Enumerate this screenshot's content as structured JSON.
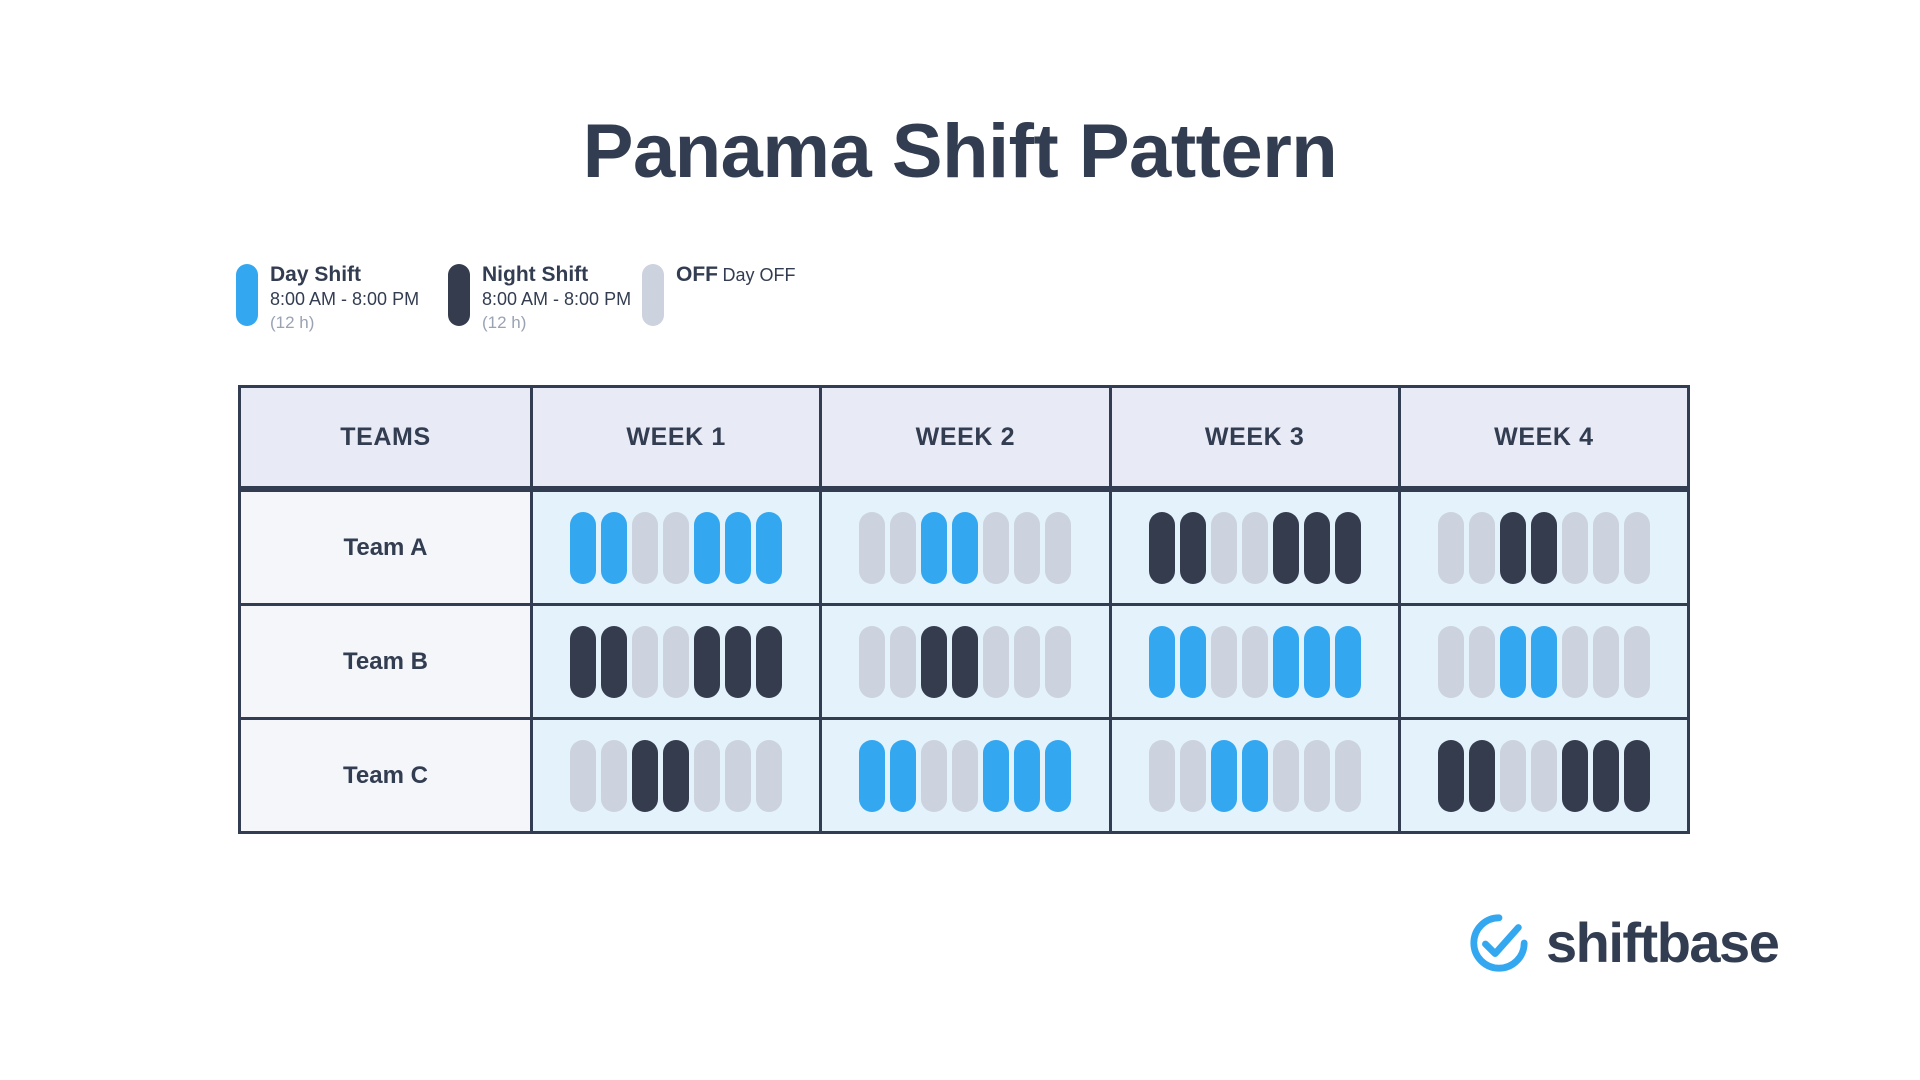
{
  "title": "Panama Shift Pattern",
  "colors": {
    "day": "#33a7f0",
    "night": "#343c4e",
    "off": "#ccd2de",
    "text_dark": "#333d51",
    "header_bg": "#e8ebf5",
    "team_cell_bg": "#f4f6f9",
    "week_cell_bg": "#e3f2fb",
    "border": "#333d51"
  },
  "legend": [
    {
      "key": "day",
      "label": "Day Shift",
      "time": "8:00 AM - 8:00 PM",
      "duration": "(12 h)"
    },
    {
      "key": "night",
      "label": "Night Shift",
      "time": "8:00 AM - 8:00 PM",
      "duration": "(12 h)"
    },
    {
      "key": "off",
      "label": "OFF",
      "time": "Day OFF",
      "duration": ""
    }
  ],
  "table": {
    "headers": [
      "TEAMS",
      "WEEK 1",
      "WEEK 2",
      "WEEK 3",
      "WEEK 4"
    ],
    "rows": [
      {
        "team": "Team A",
        "weeks": [
          [
            "D",
            "D",
            "O",
            "O",
            "D",
            "D",
            "D"
          ],
          [
            "O",
            "O",
            "D",
            "D",
            "O",
            "O",
            "O"
          ],
          [
            "N",
            "N",
            "O",
            "O",
            "N",
            "N",
            "N"
          ],
          [
            "O",
            "O",
            "N",
            "N",
            "O",
            "O",
            "O"
          ]
        ]
      },
      {
        "team": "Team B",
        "weeks": [
          [
            "N",
            "N",
            "O",
            "O",
            "N",
            "N",
            "N"
          ],
          [
            "O",
            "O",
            "N",
            "N",
            "O",
            "O",
            "O"
          ],
          [
            "D",
            "D",
            "O",
            "O",
            "D",
            "D",
            "D"
          ],
          [
            "O",
            "O",
            "D",
            "D",
            "O",
            "O",
            "O"
          ]
        ]
      },
      {
        "team": "Team C",
        "weeks": [
          [
            "O",
            "O",
            "N",
            "N",
            "O",
            "O",
            "O"
          ],
          [
            "D",
            "D",
            "O",
            "O",
            "D",
            "D",
            "D"
          ],
          [
            "O",
            "O",
            "D",
            "D",
            "O",
            "O",
            "O"
          ],
          [
            "N",
            "N",
            "O",
            "O",
            "N",
            "N",
            "N"
          ]
        ]
      }
    ]
  },
  "logo": {
    "wordmark": "shiftbase",
    "mark_icon": "check-circle-icon"
  }
}
